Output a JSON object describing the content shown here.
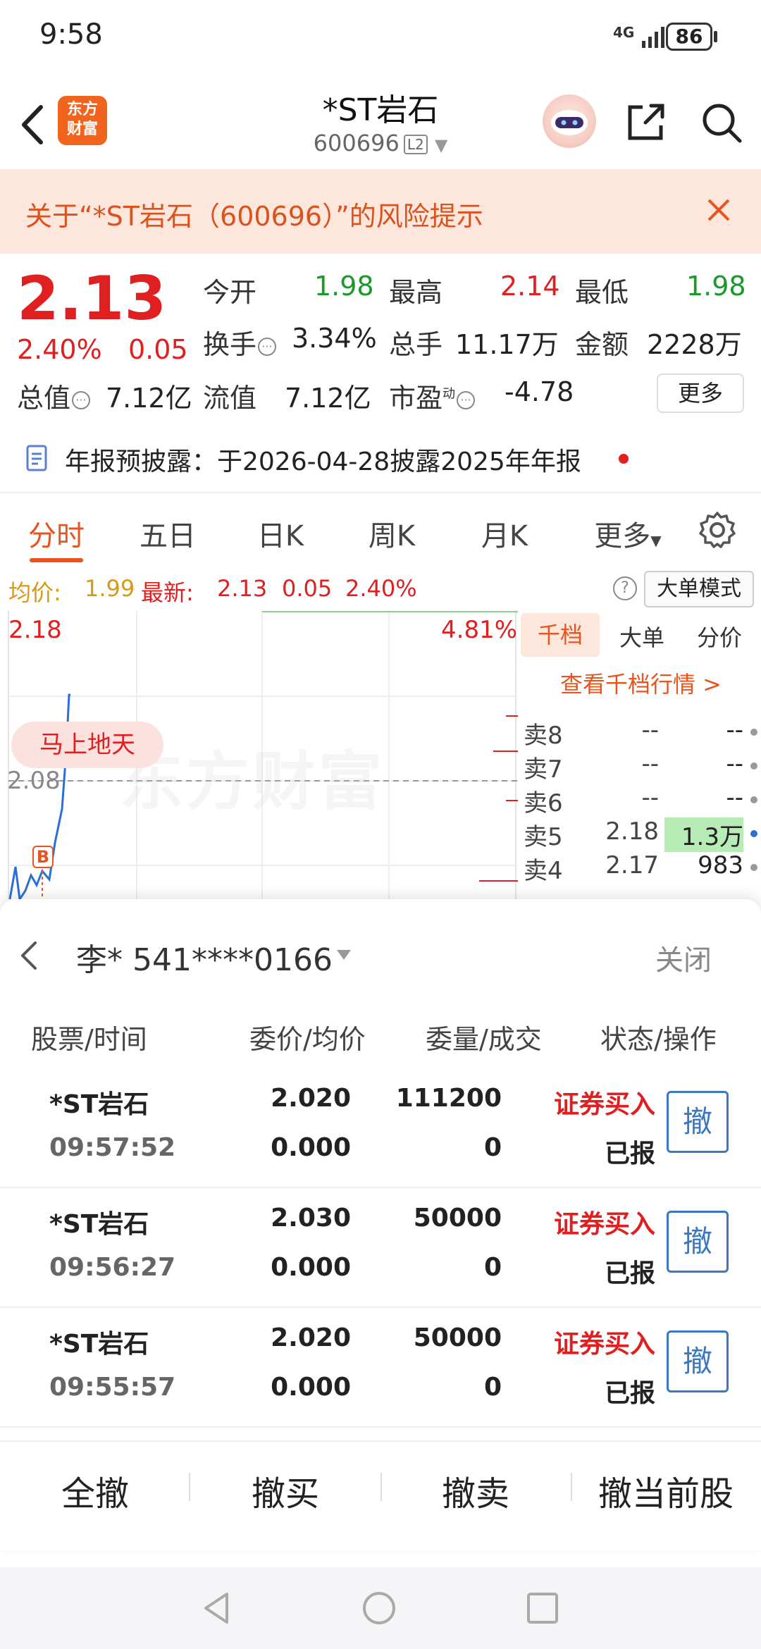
{
  "status": {
    "time": "9:58",
    "network": "4G",
    "battery": "86"
  },
  "header": {
    "logo": "东方\n财富",
    "title": "*ST岩石",
    "code": "600696",
    "level": "L2"
  },
  "risk_banner": {
    "text": "关于“*ST岩石（600696）”的风险提示"
  },
  "quote": {
    "price": "2.13",
    "change_pct": "2.40%",
    "change": "0.05",
    "open_label": "今开",
    "open": "1.98",
    "high_label": "最高",
    "high": "2.14",
    "low_label": "最低",
    "low": "1.98",
    "turnover_label": "换手",
    "turnover": "3.34%",
    "volume_label": "总手",
    "volume": "11.17万",
    "amount_label": "金额",
    "amount": "2228万",
    "mcap_label": "总值",
    "mcap": "7.12亿",
    "float_label": "流值",
    "float": "7.12亿",
    "pe_label": "市盈",
    "pe_sup": "动",
    "pe": "-4.78",
    "more": "更多"
  },
  "annual": {
    "text": "年报预披露：于2026-04-28披露2025年年报"
  },
  "tabs": [
    "分时",
    "五日",
    "日K",
    "周K",
    "月K",
    "更多"
  ],
  "chart_header": {
    "avg_label": "均价:",
    "avg": "1.99",
    "latest_label": "最新:",
    "latest": "2.13",
    "chg": "0.05",
    "pct": "2.40%",
    "mode": "大单模式"
  },
  "chart": {
    "top_price": "2.18",
    "top_pct": "4.81%",
    "ref_price": "2.08",
    "pill": "马上地天",
    "watermark": "东方财富",
    "marker": "B"
  },
  "depth": {
    "tabs": [
      "千档",
      "大单",
      "分价"
    ],
    "link": "查看千档行情 >",
    "rows": [
      {
        "label": "卖8",
        "price": "--",
        "vol": "--"
      },
      {
        "label": "卖7",
        "price": "--",
        "vol": "--"
      },
      {
        "label": "卖6",
        "price": "--",
        "vol": "--"
      },
      {
        "label": "卖5",
        "price": "2.18",
        "vol": "1.3万"
      },
      {
        "label": "卖4",
        "price": "2.17",
        "vol": "983"
      }
    ]
  },
  "account": {
    "name": "李* 541****0166",
    "close": "关闭"
  },
  "orders_header": [
    "股票/时间",
    "委价/均价",
    "委量/成交",
    "状态/操作"
  ],
  "orders": [
    {
      "name": "*ST岩石",
      "time": "09:57:52",
      "price": "2.020",
      "avg": "0.000",
      "qty": "111200",
      "filled": "0",
      "type": "证券买入",
      "status": "已报",
      "cancel": "撤"
    },
    {
      "name": "*ST岩石",
      "time": "09:56:27",
      "price": "2.030",
      "avg": "0.000",
      "qty": "50000",
      "filled": "0",
      "type": "证券买入",
      "status": "已报",
      "cancel": "撤"
    },
    {
      "name": "*ST岩石",
      "time": "09:55:57",
      "price": "2.020",
      "avg": "0.000",
      "qty": "50000",
      "filled": "0",
      "type": "证券买入",
      "status": "已报",
      "cancel": "撤"
    }
  ],
  "actions": [
    "全撤",
    "撤买",
    "撤卖",
    "撤当前股"
  ]
}
